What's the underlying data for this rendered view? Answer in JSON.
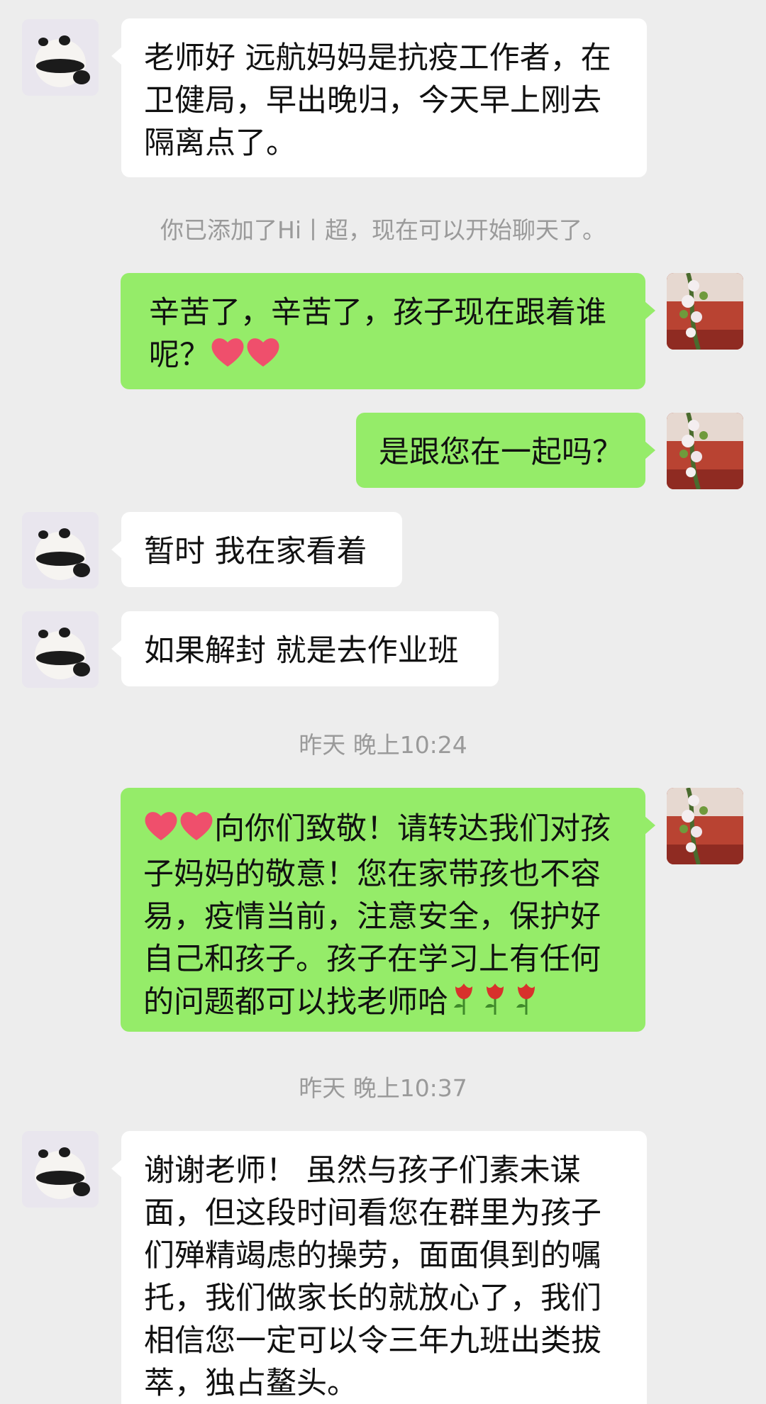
{
  "colors": {
    "background": "#ededed",
    "incoming_bubble": "#ffffff",
    "outgoing_bubble": "#95ec69",
    "system_text": "#9a9a9a"
  },
  "messages": [
    {
      "side": "in",
      "text": "老师好 远航妈妈是抗疫工作者，在卫健局，早出晚归，今天早上刚去隔离点了。"
    },
    {
      "type": "system",
      "text": "你已添加了Hi丨超，现在可以开始聊天了。"
    },
    {
      "side": "out",
      "text": "辛苦了，辛苦了，孩子现在跟着谁呢？",
      "emoji": "heart-icon heart-icon"
    },
    {
      "side": "out",
      "text": "是跟您在一起吗？"
    },
    {
      "side": "in",
      "text": "暂时 我在家看着"
    },
    {
      "side": "in",
      "text": "如果解封 就是去作业班"
    },
    {
      "type": "system",
      "text": "昨天 晚上10:24"
    },
    {
      "side": "out",
      "text": "向你们致敬！请转达我们对孩子妈妈的敬意！您在家带孩也不容易，疫情当前，注意安全，保护好自己和孩子。孩子在学习上有任何的问题都可以找老师哈",
      "emoji_before": "heart-icon heart-icon",
      "emoji_after": "rose-icon rose-icon rose-icon"
    },
    {
      "type": "system",
      "text": "昨天 晚上10:37"
    },
    {
      "side": "in",
      "text": "谢谢老师！ 虽然与孩子们素未谋面，但这段时间看您在群里为孩子们殚精竭虑的操劳，面面俱到的嘱托，我们做家长的就放心了，我们相信您一定可以令三年九班出类拔萃，独占鳌头。"
    }
  ]
}
